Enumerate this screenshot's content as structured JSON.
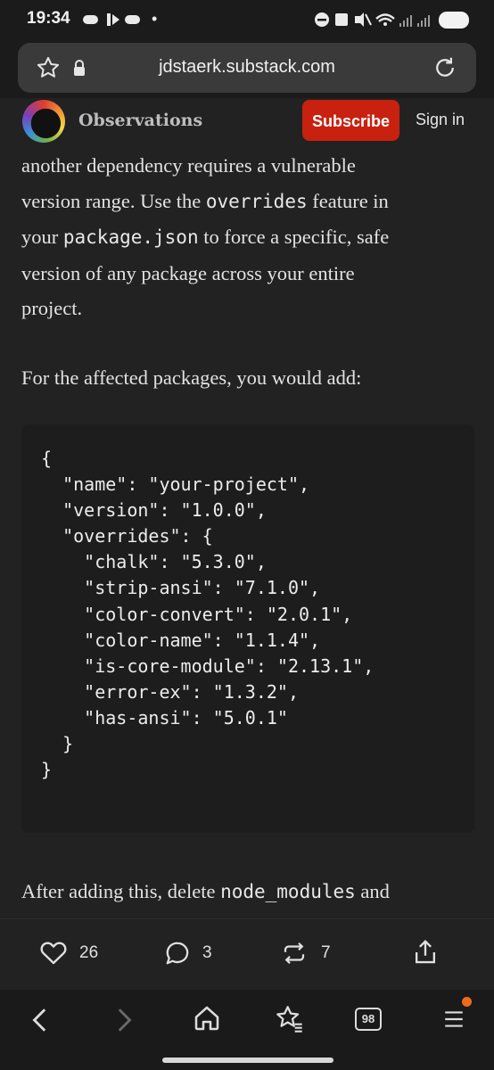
{
  "status_bar": {
    "time": "19:34"
  },
  "browser": {
    "url": "jdstaerk.substack.com"
  },
  "site": {
    "publication": "Observations",
    "subscribe_label": "Subscribe",
    "signin_label": "Sign in"
  },
  "article": {
    "para1": {
      "line0": "another dependency requires a vulnerable",
      "line1_a": "version range. Use the ",
      "line1_code": "overrides",
      "line1_b": " feature in",
      "line2_a": "your ",
      "line2_code": "package.json",
      "line2_b": " to force a specific, safe",
      "line3": "version of any package across your entire",
      "line4": "project."
    },
    "para2": "For the affected packages, you would add:",
    "code": "{\n  \"name\": \"your-project\",\n  \"version\": \"1.0.0\",\n  \"overrides\": {\n    \"chalk\": \"5.3.0\",\n    \"strip-ansi\": \"7.1.0\",\n    \"color-convert\": \"2.0.1\",\n    \"color-name\": \"1.1.4\",\n    \"is-core-module\": \"2.13.1\",\n    \"error-ex\": \"1.3.2\",\n    \"has-ansi\": \"5.0.1\"\n  }\n}",
    "para3_a": "After adding this, delete ",
    "para3_code": "node_modules",
    "para3_b": " and"
  },
  "actions": {
    "likes": "26",
    "comments": "3",
    "restacks": "7"
  },
  "bottom_nav": {
    "tabs_count": "98"
  }
}
